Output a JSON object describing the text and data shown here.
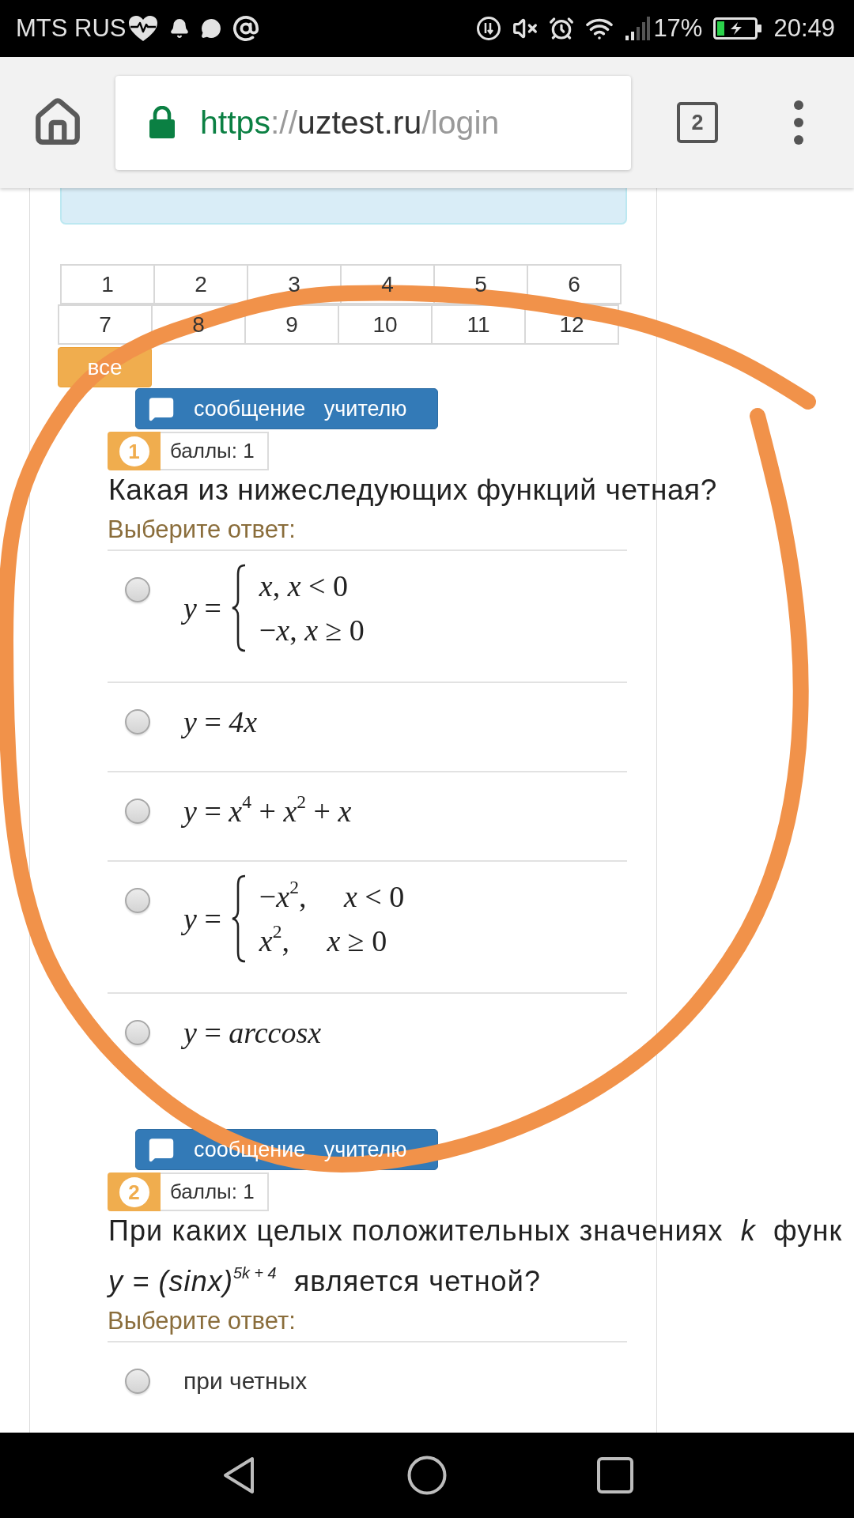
{
  "status_bar": {
    "carrier": "MTS RUS",
    "battery": "17%",
    "time": "20:49"
  },
  "browser": {
    "url": {
      "scheme": "https",
      "separator": "://",
      "host": "uztest.ru",
      "path": "/login"
    },
    "tab_count": "2"
  },
  "question_nav": {
    "rows": [
      [
        "1",
        "2",
        "3",
        "4",
        "5",
        "6"
      ],
      [
        "7",
        "8",
        "9",
        "10",
        "11",
        "12"
      ]
    ],
    "all_button": "все"
  },
  "questions": [
    {
      "message_button": "сообщение учителю",
      "number": "1",
      "points": "баллы: 1",
      "text_lines": [
        "Какая из нижеследующих функций четная?"
      ],
      "prompt": "Выберите ответ:",
      "options": [
        {
          "kind": "piecewise",
          "lhs": "*y* =",
          "cases": [
            "*x*, *x* < 0",
            "−*x*, *x* ≥ 0"
          ],
          "selected": false
        },
        {
          "kind": "formula",
          "text": "*y* = *4x*",
          "selected": false
        },
        {
          "kind": "formula",
          "text": "*y* = *x*$^{4}$ + *x*$^{2}$ + *x*",
          "selected": false
        },
        {
          "kind": "piecewise",
          "lhs": "*y* =",
          "cases": [
            "−*x*$^{2}$,     *x* < 0",
            "*x*$^{2}$,     *x* ≥ 0"
          ],
          "selected": false
        },
        {
          "kind": "formula",
          "text": "*y* = *arccosx*",
          "selected": false
        }
      ]
    },
    {
      "message_button": "сообщение учителю",
      "number": "2",
      "points": "баллы: 1",
      "text_lines": [
        "При каких целых положительных значениях  *k*  функ",
        "*y = (sinx)*$^{5k + 4}$  является четной?"
      ],
      "prompt": "Выберите ответ:",
      "options": [
        {
          "kind": "text",
          "text": "при четных",
          "selected": false
        }
      ]
    }
  ]
}
